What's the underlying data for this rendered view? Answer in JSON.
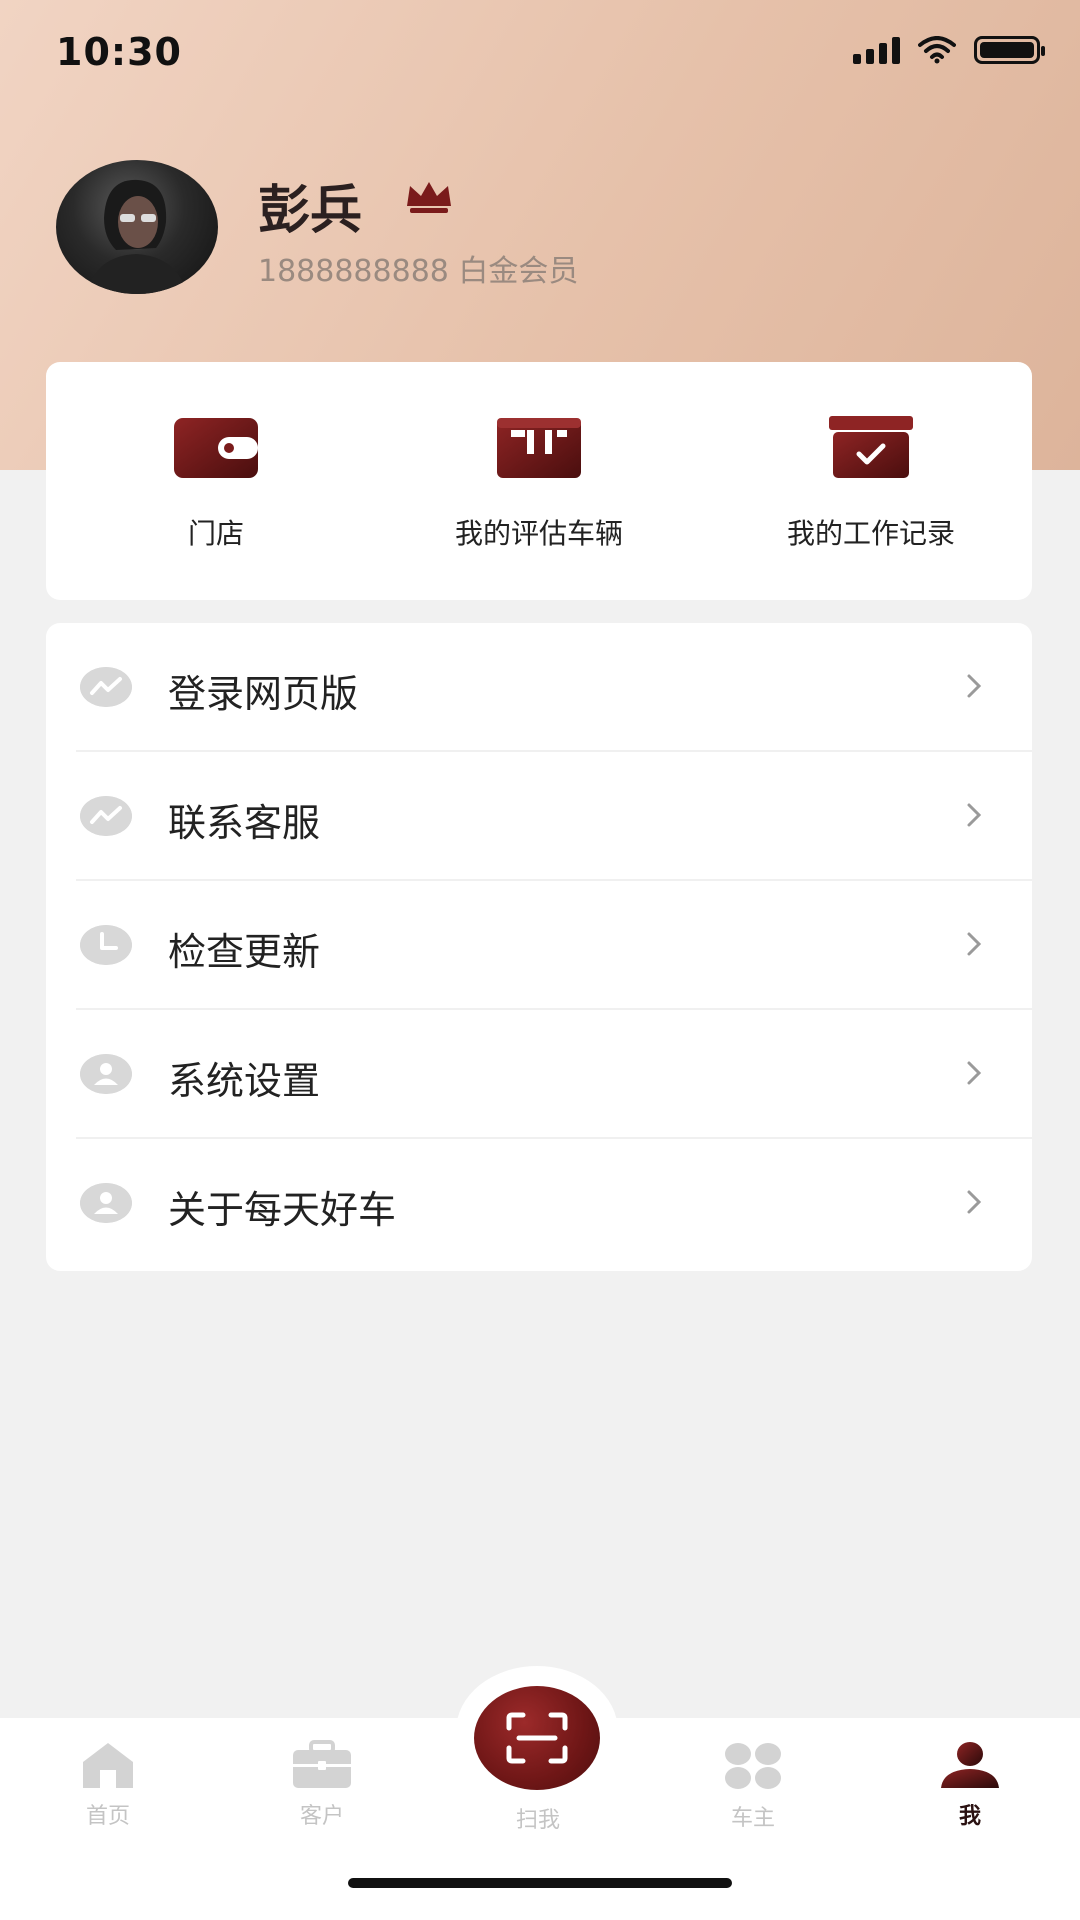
{
  "status_bar": {
    "time": "10:30"
  },
  "profile": {
    "name": "彭兵",
    "phone": "1888888888",
    "member_level": "白金会员"
  },
  "quick_actions": [
    {
      "label": "门店",
      "icon": "wallet-icon"
    },
    {
      "label": "我的评估车辆",
      "icon": "box-open-icon"
    },
    {
      "label": "我的工作记录",
      "icon": "archive-check-icon"
    }
  ],
  "menu": [
    {
      "label": "登录网页版",
      "icon": "activity-icon"
    },
    {
      "label": "联系客服",
      "icon": "activity-icon"
    },
    {
      "label": "检查更新",
      "icon": "clock-icon"
    },
    {
      "label": "系统设置",
      "icon": "user-icon"
    },
    {
      "label": "关于每天好车",
      "icon": "user-icon"
    }
  ],
  "tabbar": {
    "items": [
      {
        "label": "首页",
        "icon": "home-icon"
      },
      {
        "label": "客户",
        "icon": "briefcase-icon"
      },
      {
        "label": "扫我",
        "icon": "scan-icon"
      },
      {
        "label": "车主",
        "icon": "grid-icon"
      },
      {
        "label": "我",
        "icon": "person-icon"
      }
    ],
    "active": "我"
  },
  "colors": {
    "accent": "#7a1b1b",
    "header_gradient_start": "#f1d4c3",
    "header_gradient_end": "#ddb49b",
    "page_bg": "#f1f1f1",
    "muted_icon": "#d8d8d8"
  }
}
